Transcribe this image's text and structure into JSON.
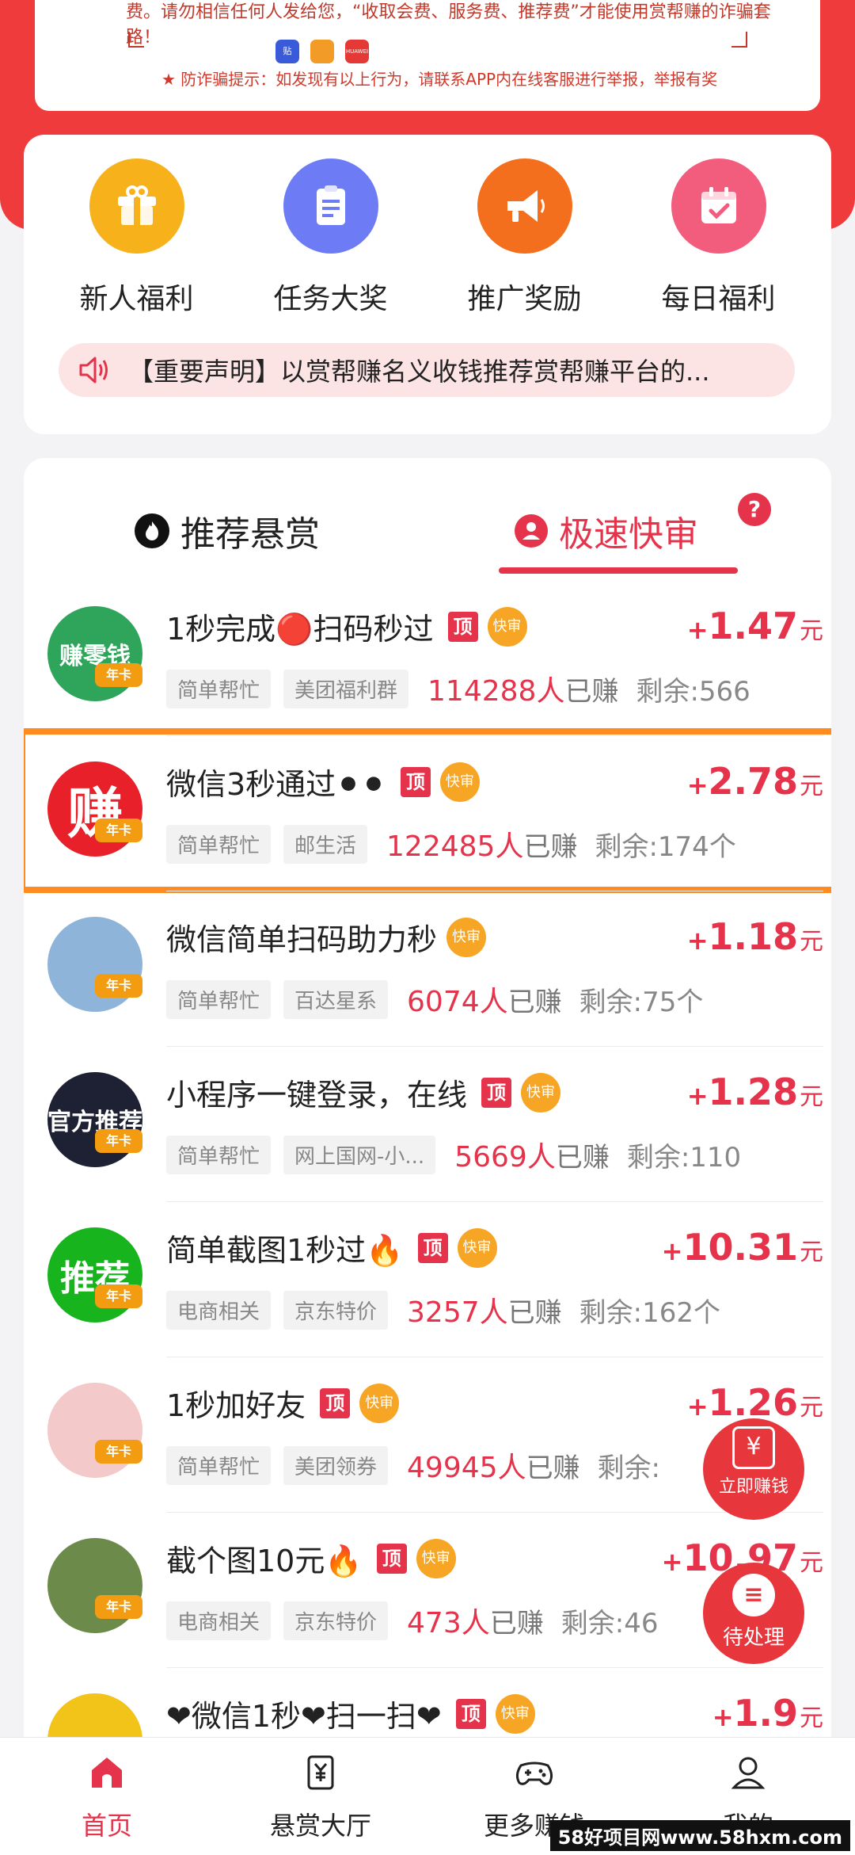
{
  "notice": {
    "text": "费。请勿相信任何人发给您，“收取会费、服务费、推荐费”才能使用赏帮赚的诈骗套路！",
    "brand_icons": [
      "贴",
      "",
      "HUAWEI"
    ],
    "warning": "★ 防诈骗提示：如发现有以上行为，请联系APP内在线客服进行举报，举报有奖"
  },
  "quick_entries": [
    {
      "label": "新人福利",
      "icon": "gift-icon",
      "color": "#f7b21b"
    },
    {
      "label": "任务大奖",
      "icon": "clipboard-icon",
      "color": "#6d7cf5"
    },
    {
      "label": "推广奖励",
      "icon": "megaphone-icon",
      "color": "#f36f1d"
    },
    {
      "label": "每日福利",
      "icon": "calendar-check-icon",
      "color": "#f25d7d"
    }
  ],
  "announcement": {
    "icon": "speaker-icon",
    "text": "【重要声明】以赏帮赚名义收钱推荐赏帮赚平台的..."
  },
  "tabs": {
    "recommend": "推荐悬赏",
    "fast": "极速快审",
    "help": "?"
  },
  "tags": {
    "top": "顶",
    "fast": "快审",
    "year": "年卡",
    "unit": "元",
    "plus": "+"
  },
  "tasks": [
    {
      "title": "1秒完成🔴扫码秒过",
      "top": true,
      "reward": "1.47",
      "chips": [
        "简单帮忙",
        "美团福利群"
      ],
      "earned_count": "114288人",
      "earned_suffix": "已赚",
      "remain": "剩余:566",
      "avatar_text": "赚零钱",
      "avatar_color": "#2ea55a"
    },
    {
      "title": "微信3秒通过⚫⚫",
      "top": true,
      "reward": "2.78",
      "chips": [
        "简单帮忙",
        "邮生活"
      ],
      "earned_count": "122485人",
      "earned_suffix": "已赚",
      "remain": "剩余:174个",
      "avatar_text": "赚",
      "avatar_color": "#e8202a"
    },
    {
      "title": "微信简单扫码助力秒",
      "top": false,
      "reward": "1.18",
      "chips": [
        "简单帮忙",
        "百达星系"
      ],
      "earned_count": "6074人",
      "earned_suffix": "已赚",
      "remain": "剩余:75个",
      "avatar_text": "",
      "avatar_color": "#8fb4d9"
    },
    {
      "title": "小程序一键登录，在线",
      "top": true,
      "reward": "1.28",
      "chips": [
        "简单帮忙",
        "网上国网-小..."
      ],
      "earned_count": "5669人",
      "earned_suffix": "已赚",
      "remain": "剩余:110",
      "avatar_text": "官方推荐",
      "avatar_color": "#1e2133"
    },
    {
      "title": "简单截图1秒过🔥",
      "top": true,
      "reward": "10.31",
      "chips": [
        "电商相关",
        "京东特价"
      ],
      "earned_count": "3257人",
      "earned_suffix": "已赚",
      "remain": "剩余:162个",
      "avatar_text": "推荐",
      "avatar_color": "#17b41e"
    },
    {
      "title": "1秒加好友",
      "top": true,
      "reward": "1.26",
      "chips": [
        "简单帮忙",
        "美团领券"
      ],
      "earned_count": "49945人",
      "earned_suffix": "已赚",
      "remain": "剩余:",
      "avatar_text": "",
      "avatar_color": "#f3c9c9"
    },
    {
      "title": "截个图10元🔥",
      "top": true,
      "reward": "10.97",
      "chips": [
        "电商相关",
        "京东特价"
      ],
      "earned_count": "473人",
      "earned_suffix": "已赚",
      "remain": "剩余:46",
      "avatar_text": "",
      "avatar_color": "#6c8a4a"
    },
    {
      "title": "❤微信1秒❤扫一扫❤",
      "top": true,
      "reward": "1.9",
      "chips": [],
      "earned_count": "",
      "earned_suffix": "",
      "remain": "",
      "avatar_text": "",
      "avatar_color": "#f2c318"
    }
  ],
  "floating": {
    "earn": "立即赚钱",
    "earn_icon": "¥",
    "pending": "待处理"
  },
  "bottom_nav": [
    {
      "label": "首页",
      "icon": "home-icon",
      "active": true
    },
    {
      "label": "悬赏大厅",
      "icon": "yen-doc-icon",
      "active": false
    },
    {
      "label": "更多赚钱",
      "icon": "gamepad-icon",
      "active": false
    },
    {
      "label": "我的",
      "icon": "user-icon",
      "active": false
    }
  ],
  "watermark": "58好项目网www.58hxm.com"
}
